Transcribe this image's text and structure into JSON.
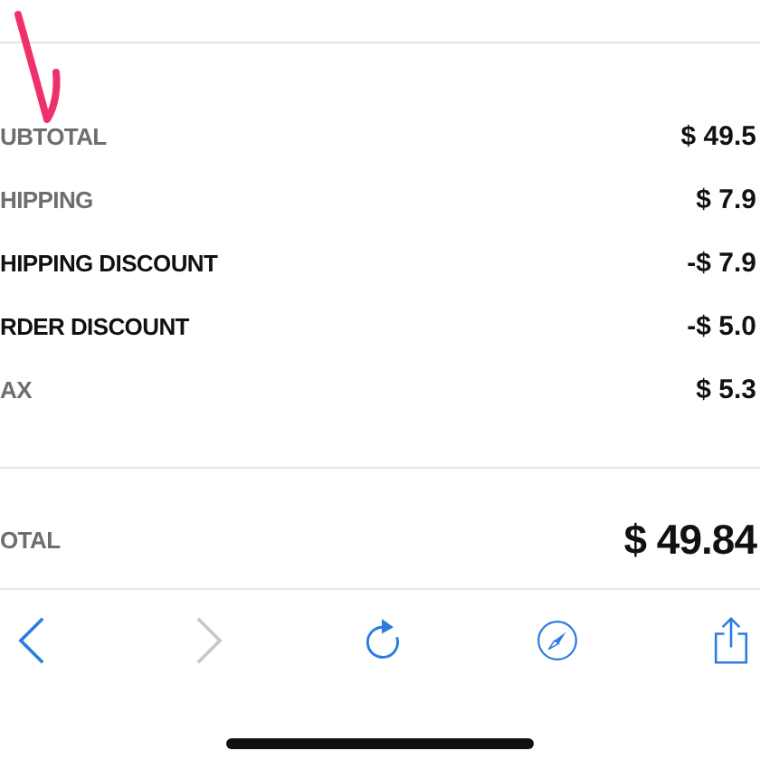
{
  "summary": [
    {
      "label": "UBTOTAL",
      "value": "$ 49.5",
      "emphasis": false
    },
    {
      "label": "HIPPING",
      "value": "$ 7.9",
      "emphasis": false
    },
    {
      "label": "HIPPING DISCOUNT",
      "value": "-$ 7.9",
      "emphasis": true
    },
    {
      "label": "RDER DISCOUNT",
      "value": "-$ 5.0",
      "emphasis": true
    },
    {
      "label": "AX",
      "value": "$ 5.3",
      "emphasis": false
    }
  ],
  "total": {
    "label": "OTAL",
    "value": "$ 49.84"
  }
}
